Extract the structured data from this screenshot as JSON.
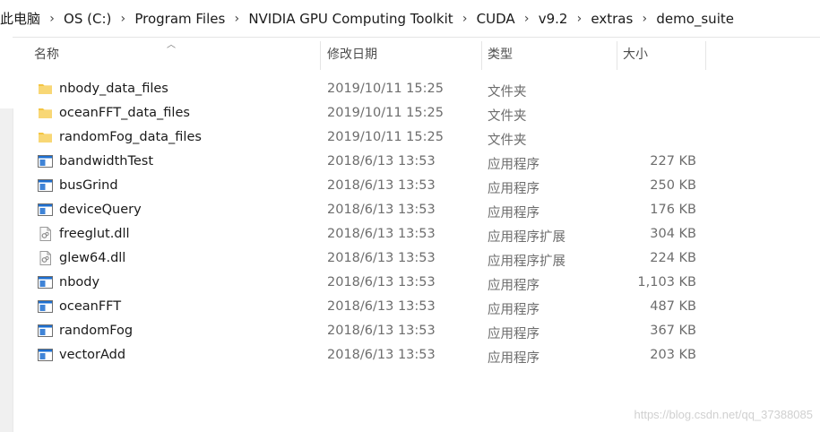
{
  "breadcrumb": [
    "此电脑",
    "OS (C:)",
    "Program Files",
    "NVIDIA GPU Computing Toolkit",
    "CUDA",
    "v9.2",
    "extras",
    "demo_suite"
  ],
  "columns": {
    "name": "名称",
    "date": "修改日期",
    "type": "类型",
    "size": "大小"
  },
  "sort_column": "name",
  "files": [
    {
      "name": "nbody_data_files",
      "date": "2019/10/11 15:25",
      "type": "文件夹",
      "size": "",
      "icon": "folder-icon"
    },
    {
      "name": "oceanFFT_data_files",
      "date": "2019/10/11 15:25",
      "type": "文件夹",
      "size": "",
      "icon": "folder-icon"
    },
    {
      "name": "randomFog_data_files",
      "date": "2019/10/11 15:25",
      "type": "文件夹",
      "size": "",
      "icon": "folder-icon"
    },
    {
      "name": "bandwidthTest",
      "date": "2018/6/13 13:53",
      "type": "应用程序",
      "size": "227 KB",
      "icon": "application-icon"
    },
    {
      "name": "busGrind",
      "date": "2018/6/13 13:53",
      "type": "应用程序",
      "size": "250 KB",
      "icon": "application-icon"
    },
    {
      "name": "deviceQuery",
      "date": "2018/6/13 13:53",
      "type": "应用程序",
      "size": "176 KB",
      "icon": "application-icon"
    },
    {
      "name": "freeglut.dll",
      "date": "2018/6/13 13:53",
      "type": "应用程序扩展",
      "size": "304 KB",
      "icon": "dll-file-icon"
    },
    {
      "name": "glew64.dll",
      "date": "2018/6/13 13:53",
      "type": "应用程序扩展",
      "size": "224 KB",
      "icon": "dll-file-icon"
    },
    {
      "name": "nbody",
      "date": "2018/6/13 13:53",
      "type": "应用程序",
      "size": "1,103 KB",
      "icon": "application-icon"
    },
    {
      "name": "oceanFFT",
      "date": "2018/6/13 13:53",
      "type": "应用程序",
      "size": "487 KB",
      "icon": "application-icon"
    },
    {
      "name": "randomFog",
      "date": "2018/6/13 13:53",
      "type": "应用程序",
      "size": "367 KB",
      "icon": "application-icon"
    },
    {
      "name": "vectorAdd",
      "date": "2018/6/13 13:53",
      "type": "应用程序",
      "size": "203 KB",
      "icon": "application-icon"
    }
  ],
  "watermark": "https://blog.csdn.net/qq_37388085",
  "colors": {
    "folder": "#f4c542",
    "app_icon": "#1e6fd0",
    "muted_text": "#6d6d6d"
  }
}
